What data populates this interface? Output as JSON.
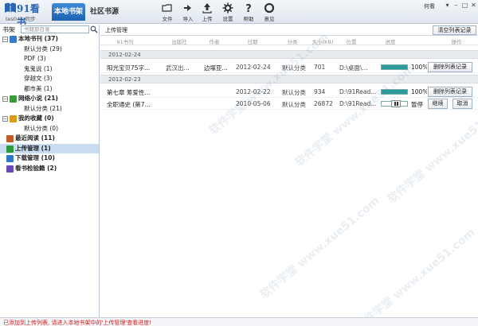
{
  "app": {
    "logo_text": "91看书",
    "user_line": "tes041 同步",
    "tab_bookshelf": "本地书架",
    "tab_community": "社区书源",
    "win_user": "何看"
  },
  "toolbar": [
    {
      "label": "文件",
      "icon": "folder-icon"
    },
    {
      "label": "导入",
      "icon": "import-icon"
    },
    {
      "label": "上传",
      "icon": "upload-icon"
    },
    {
      "label": "设置",
      "icon": "gear-icon"
    },
    {
      "label": "帮助",
      "icon": "help-icon"
    },
    {
      "label": "意见",
      "icon": "feedback-icon"
    }
  ],
  "sidebar": {
    "title": "书架",
    "search_placeholder": "书籍那目录",
    "nodes": [
      {
        "label": "本地书刊 (37)",
        "level": 0,
        "group": true,
        "expander": "−",
        "icon": "local-books-icon"
      },
      {
        "label": "默认分类 (29)",
        "level": 1
      },
      {
        "label": "PDF (3)",
        "level": 1
      },
      {
        "label": "鬼鬼说 (1)",
        "level": 1
      },
      {
        "label": "穿越文 (3)",
        "level": 1
      },
      {
        "label": "都市美 (1)",
        "level": 1
      },
      {
        "label": "网络小说 (21)",
        "level": 0,
        "group": true,
        "expander": "−",
        "icon": "web-novel-icon"
      },
      {
        "label": "默认分类 (21)",
        "level": 1
      },
      {
        "label": "我的收藏 (0)",
        "level": 0,
        "group": true,
        "expander": "−",
        "icon": "favorites-icon"
      },
      {
        "label": "默认分类 (0)",
        "level": 1
      },
      {
        "label": "最近阅读 (11)",
        "level": 0,
        "group": true,
        "icon": "recent-reading-icon"
      },
      {
        "label": "上传管理 (1)",
        "level": 0,
        "group": true,
        "selected": true,
        "icon": "upload-manage-icon"
      },
      {
        "label": "下载管理 (10)",
        "level": 0,
        "group": true,
        "icon": "download-manage-icon"
      },
      {
        "label": "看书检验籍 (2)",
        "level": 0,
        "group": true,
        "icon": "book-check-icon"
      }
    ]
  },
  "main": {
    "title": "上传管理",
    "clear_all_button": "清空列表记录",
    "columns": [
      "91书刊",
      "出版社",
      "作者",
      "日期",
      "分类",
      "大小(KB)",
      "位置",
      "进度",
      "操作"
    ],
    "groups": [
      {
        "date": "2012-02-24",
        "rows": [
          {
            "title": "阳光宝贝75字...",
            "publisher": "武汉出...",
            "author": "边塚亚...",
            "date": "2012-02-24",
            "category": "默认分类",
            "size": "701",
            "location": "D:\\桌面\\...",
            "progress": 100,
            "progress_text": "100%",
            "action": "删除列表记录"
          }
        ]
      },
      {
        "date": "2012-02-23",
        "rows": [
          {
            "title": "第七章 筹爱性...",
            "publisher": "",
            "author": "",
            "date": "2012-02-22",
            "category": "默认分类",
            "size": "934",
            "location": "D:\\91Read...",
            "progress": 100,
            "progress_text": "100%",
            "action": "删除列表记录"
          },
          {
            "title": "全职通史 (第7...",
            "publisher": "",
            "author": "",
            "date": "2010-05-06",
            "category": "默认分类",
            "size": "26872",
            "location": "D:\\91Read...",
            "progress": 0,
            "progress_text": "暂停",
            "action": "继续",
            "action2": "取消"
          }
        ]
      }
    ]
  },
  "watermark": "软件学堂 www.xue51.com",
  "status": "已添加到上传列表, 请进入本地书架中的'上传管理'查看进度!",
  "colors": {
    "accent": "#1e62b2",
    "progress": "#2a9a9a",
    "status_text": "#d21f1f",
    "selected_row": "#c9dcf2"
  }
}
